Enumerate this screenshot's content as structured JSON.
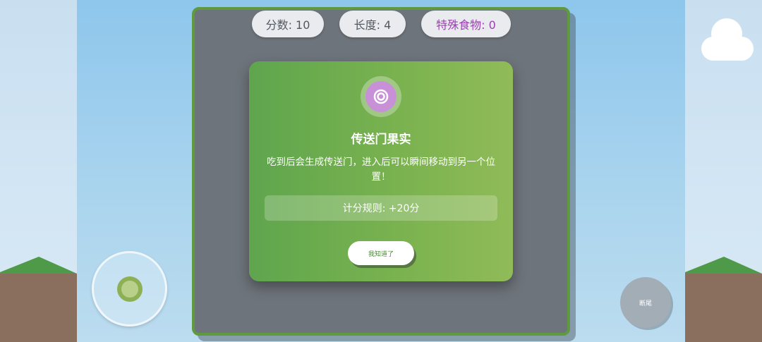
{
  "hud": {
    "score": "分数: 10",
    "length": "长度: 4",
    "special_food": "特殊食物: 0"
  },
  "modal": {
    "icon": "portal-icon",
    "title": "传送门果实",
    "description": "吃到后会生成传送门，进入后可以瞬间移动到另一个位置！",
    "rule": "计分规则: +20分",
    "confirm_label": "我知道了"
  },
  "controls": {
    "joystick_icon": "joystick-knob",
    "cut_tail_label": "断尾"
  },
  "colors": {
    "board_border": "#5f9a3e",
    "board_bg": "#6e747b",
    "modal_start": "#5fa54e",
    "modal_end": "#90bb58",
    "special_text": "#9b3fb1",
    "portal": "#c890d6"
  }
}
